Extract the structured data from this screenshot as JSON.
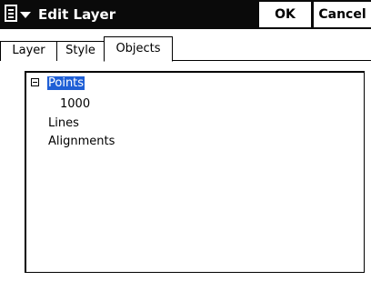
{
  "window": {
    "title": "Edit Layer",
    "ok_label": "OK",
    "cancel_label": "Cancel"
  },
  "tabs": [
    {
      "label": "Layer",
      "selected": false
    },
    {
      "label": "Style",
      "selected": false
    },
    {
      "label": "Objects",
      "selected": true
    }
  ],
  "tree": {
    "nodes": [
      {
        "label": "Points",
        "expanded": true,
        "selected": true,
        "children": [
          {
            "label": "1000"
          }
        ]
      },
      {
        "label": "Lines"
      },
      {
        "label": "Alignments"
      }
    ]
  },
  "colors": {
    "titlebar": "#0a0a0a",
    "selection": "#1f5fd6"
  },
  "icons": {
    "start_menu": "document-icon",
    "start_dropdown": "triangle-down-icon",
    "tree_expander": "minus-box-icon"
  }
}
